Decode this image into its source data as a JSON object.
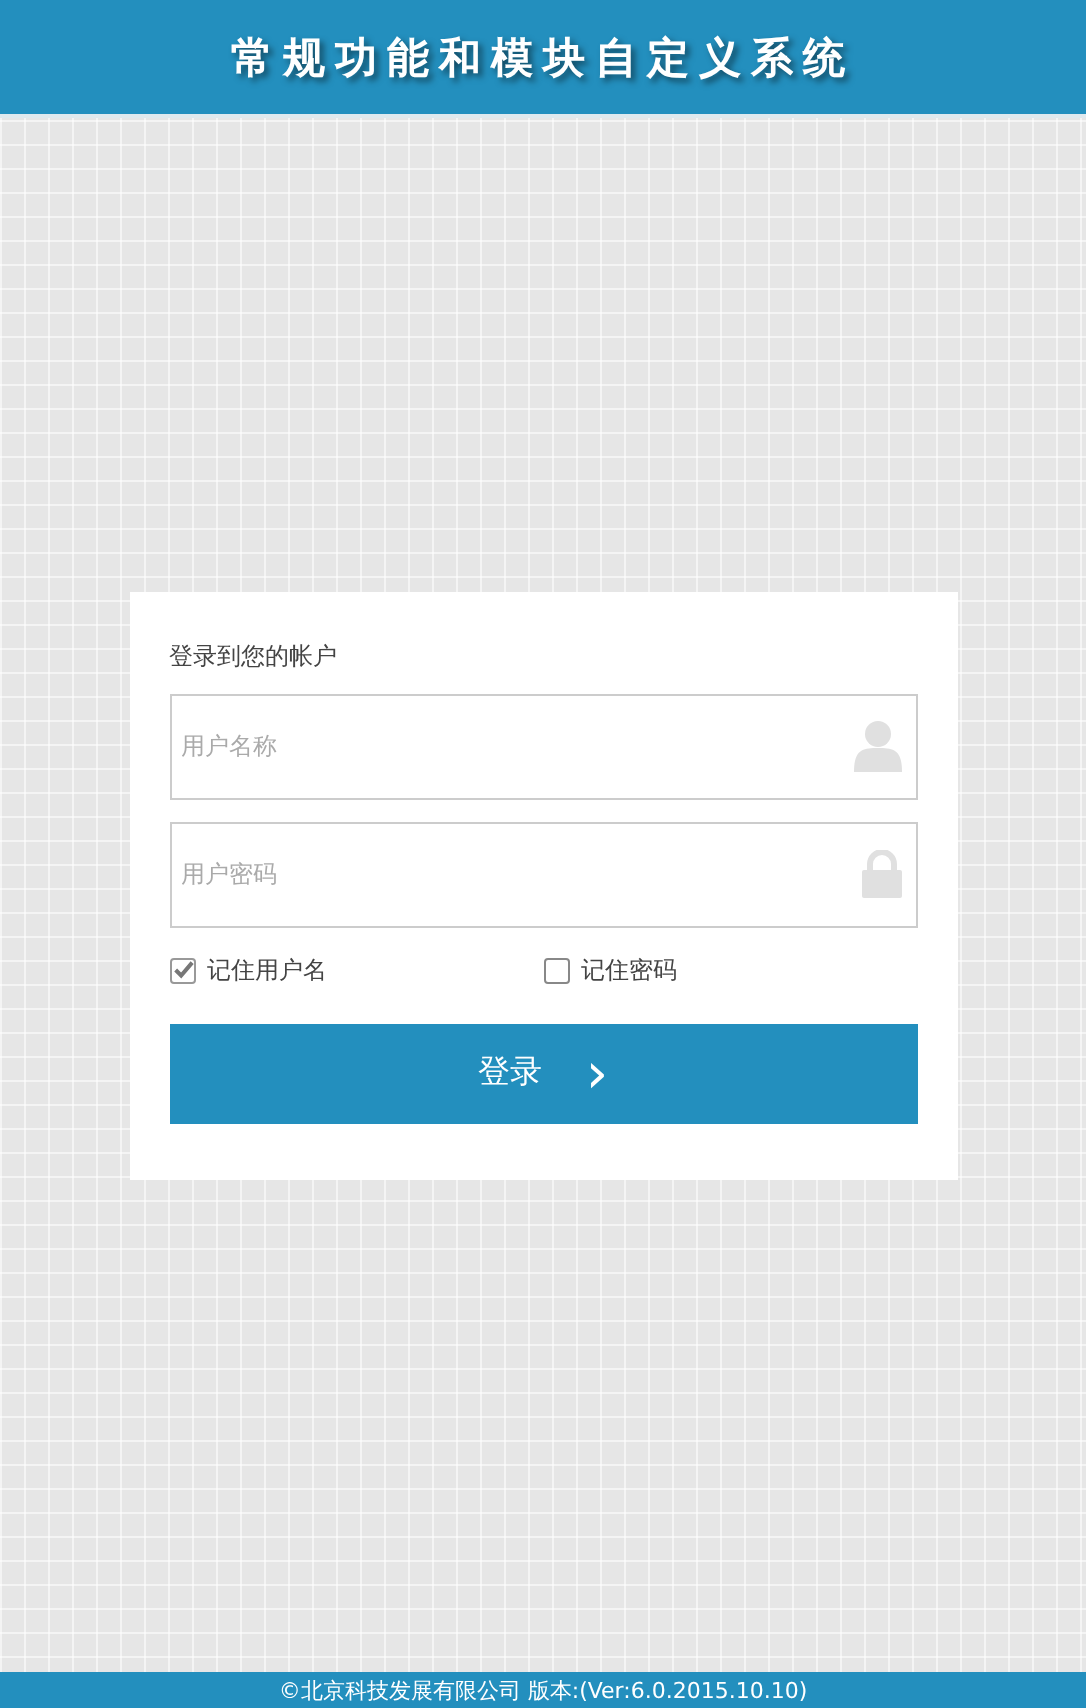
{
  "header": {
    "title": "常规功能和模块自定义系统"
  },
  "login": {
    "heading": "登录到您的帐户",
    "fields": [
      {
        "kind": "user",
        "placeholder": "用户名称"
      },
      {
        "kind": "password",
        "placeholder": "用户密码"
      }
    ],
    "options": [
      {
        "label": "记住用户名",
        "checked": true
      },
      {
        "label": "记住密码",
        "checked": false
      }
    ],
    "submit": {
      "label": "登录",
      "icon": "›"
    }
  },
  "footer": {
    "text": "©北京科技发展有限公司 版本:(Ver:6.0.2015.10.10)"
  }
}
